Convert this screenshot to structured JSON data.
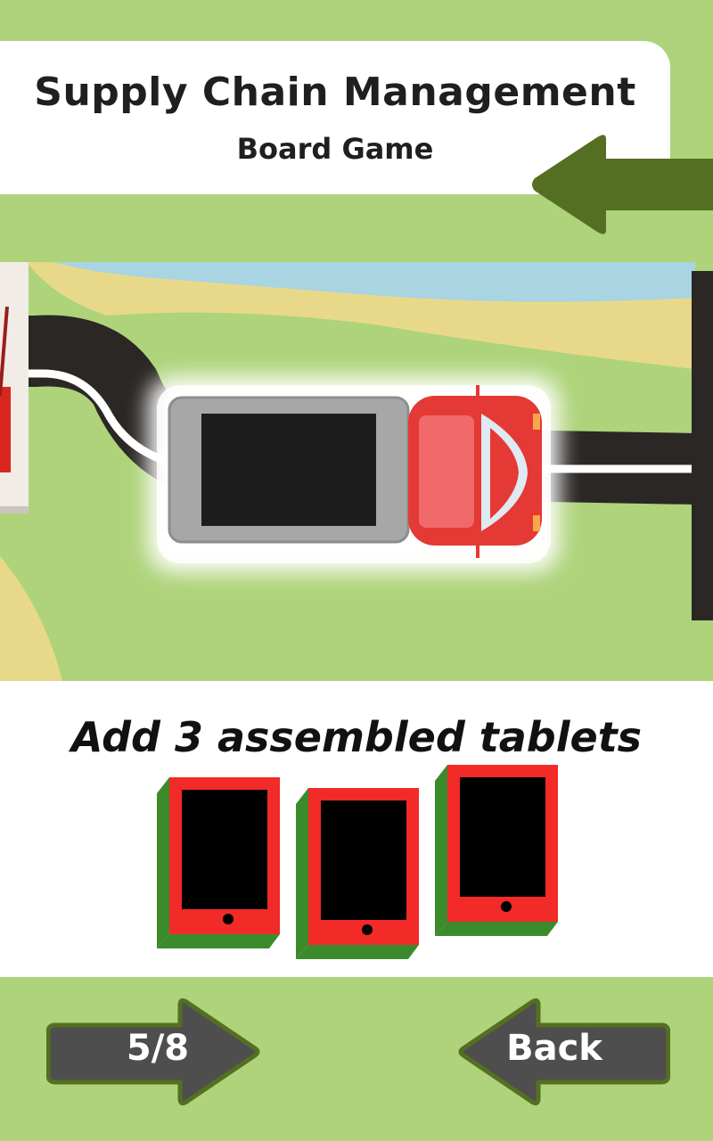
{
  "header": {
    "title": "Supply Chain Management",
    "subtitle": "Board Game"
  },
  "scene": {
    "vehicle": "delivery-truck",
    "road": "winding-road"
  },
  "card": {
    "instruction": "Add 3 assembled tablets",
    "items": [
      {
        "name": "tablet",
        "state": "assembled"
      },
      {
        "name": "tablet",
        "state": "assembled"
      },
      {
        "name": "tablet",
        "state": "assembled"
      }
    ]
  },
  "nav": {
    "progress": "5/8",
    "back_label": "Back"
  },
  "colors": {
    "background": "#aed37a",
    "arrow": "#556f22",
    "button": "#4e4e4e",
    "tablet_red": "#f22a28",
    "tablet_green": "#3b8b2c"
  }
}
